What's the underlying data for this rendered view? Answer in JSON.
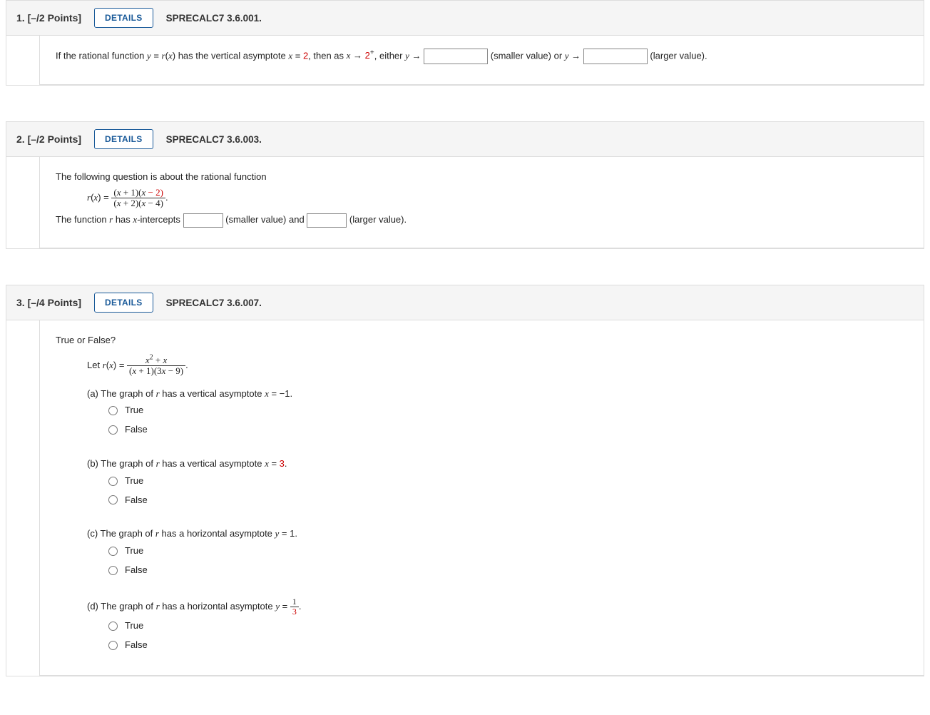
{
  "details_label": "DETAILS",
  "tf_true": "True",
  "tf_false": "False",
  "q1": {
    "num": "1.",
    "points": "[–/2 Points]",
    "ref": "SPRECALC7 3.6.001.",
    "text_before": "If the rational function  ",
    "eq1_lhs": "y",
    "eq1_eq": " = ",
    "eq1_rhs_r": "r",
    "eq1_rhs_paren": "(",
    "eq1_rhs_x": "x",
    "eq1_rhs_close": ")",
    "text_mid1": "  has the vertical asymptote  ",
    "eq2_lhs": "x",
    "eq2_eq": " = ",
    "eq2_rhs": "2",
    "text_mid2": ",  then as  ",
    "limit_x": "x",
    "limit_arrow": " → ",
    "limit_val": "2",
    "limit_sup": "+",
    "text_mid3": ",  either  ",
    "y1": "y",
    "arrow1": " → ",
    "after1": " (smaller value)  or  ",
    "y2": "y",
    "arrow2": " → ",
    "after2": " (larger value)."
  },
  "q2": {
    "num": "2.",
    "points": "[–/2 Points]",
    "ref": "SPRECALC7 3.6.003.",
    "intro": "The following question is about the rational function",
    "r": "r",
    "paren_open": "(",
    "x": "x",
    "paren_close": ")",
    "eq": " = ",
    "num_open": "(",
    "num_x1": "x",
    "num_plus": " + 1)(",
    "num_x2": "x",
    "num_close": " − 2)",
    "den_open": "(",
    "den_x1": "x",
    "den_plus": " + 2)(",
    "den_x2": "x",
    "den_close": " − 4)",
    "period": ".",
    "line2_before": "The function ",
    "line2_r": "r",
    "line2_mid": " has ",
    "line2_xint": "x",
    "line2_after": "-intercepts ",
    "smaller": " (smaller value) and ",
    "larger": " (larger value)."
  },
  "q3": {
    "num": "3.",
    "points": "[–/4 Points]",
    "ref": "SPRECALC7 3.6.007.",
    "heading": "True or False?",
    "let": "Let  ",
    "r": "r",
    "paren_open": "(",
    "x": "x",
    "paren_close": ")",
    "eq": " = ",
    "num_x2": "x",
    "num_sup": "2",
    "num_plus": " + ",
    "num_x": "x",
    "den_open": "(",
    "den_x1": "x",
    "den_mid": " + 1)(3",
    "den_x2": "x",
    "den_close": " − 9)",
    "period": ".",
    "a": {
      "label": "(a) The graph of ",
      "r": "r",
      "mid": " has a vertical asymptote  ",
      "var": "x",
      "eq": " = ",
      "val": "−1.",
      "val_red": false
    },
    "b": {
      "label": "(b) The graph of ",
      "r": "r",
      "mid": " has a vertical asymptote  ",
      "var": "x",
      "eq": " = ",
      "val": "3",
      "val_red": true,
      "period": "."
    },
    "c": {
      "label": "(c) The graph of ",
      "r": "r",
      "mid": " has a horizontal asymptote  ",
      "var": "y",
      "eq": " = ",
      "val": "1.",
      "val_red": false
    },
    "d": {
      "label": "(d) The graph of ",
      "r": "r",
      "mid": " has a horizontal asymptote  ",
      "var": "y",
      "eq": " = ",
      "frac_num": "1",
      "frac_den": "3",
      "period": "."
    }
  }
}
